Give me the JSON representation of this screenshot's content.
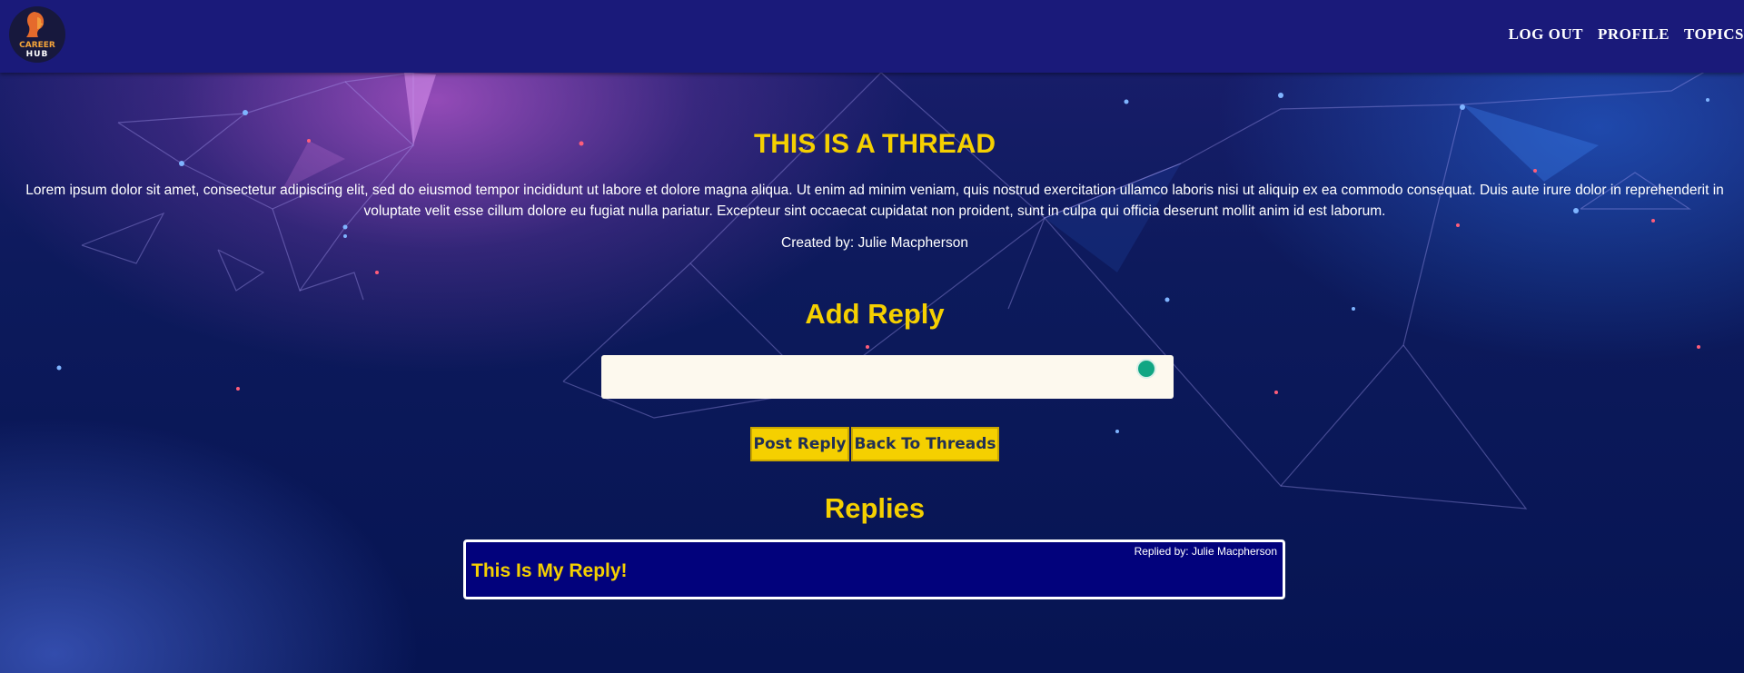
{
  "brand": {
    "logo_line1": "CAREER",
    "logo_line2": "HUB"
  },
  "nav": {
    "logout": "LOG OUT",
    "profile": "PROFILE",
    "topics": "TOPICS"
  },
  "thread": {
    "title": "THIS IS A THREAD",
    "body": "Lorem ipsum dolor sit amet, consectetur adipiscing elit, sed do eiusmod tempor incididunt ut labore et dolore magna aliqua. Ut enim ad minim veniam, quis nostrud exercitation ullamco laboris nisi ut aliquip ex ea commodo consequat. Duis aute irure dolor in reprehenderit in voluptate velit esse cillum dolore eu fugiat nulla pariatur. Excepteur sint occaecat cupidatat non proident, sunt in culpa qui officia deserunt mollit anim id est laborum.",
    "created_by": "Created by: Julie Macpherson"
  },
  "reply_form": {
    "title": "Add Reply",
    "input_value": "",
    "post_label": "Post Reply",
    "back_label": "Back To Threads"
  },
  "replies": {
    "title": "Replies",
    "items": [
      {
        "text": "This Is My Reply!",
        "by": "Replied by: Julie Macpherson"
      }
    ]
  },
  "colors": {
    "accent": "#f5d000",
    "header": "#1a1a7a",
    "reply_card": "#02027c"
  },
  "icons": {
    "logo": "career-hub-logo",
    "grammar": "grammarly-icon"
  }
}
